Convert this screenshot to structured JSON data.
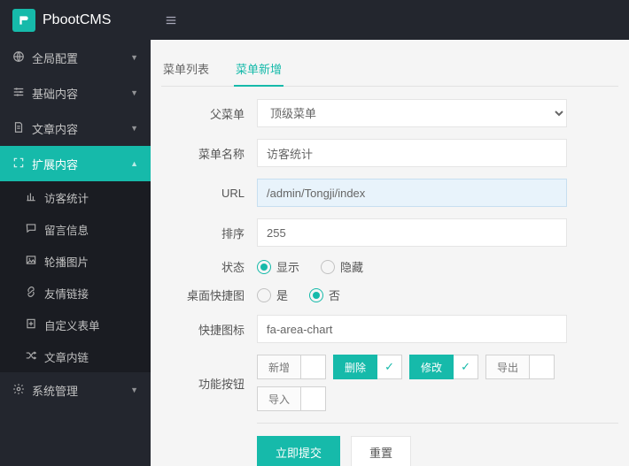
{
  "brand": {
    "name": "PbootCMS",
    "logo_glyph": "⎙"
  },
  "sidebar": {
    "items": [
      {
        "label": "全局配置",
        "icon": "globe"
      },
      {
        "label": "基础内容",
        "icon": "sliders"
      },
      {
        "label": "文章内容",
        "icon": "doc"
      },
      {
        "label": "扩展内容",
        "icon": "expand",
        "active": true,
        "children": [
          {
            "label": "访客统计",
            "icon": "chart"
          },
          {
            "label": "留言信息",
            "icon": "msg"
          },
          {
            "label": "轮播图片",
            "icon": "image"
          },
          {
            "label": "友情链接",
            "icon": "link"
          },
          {
            "label": "自定义表单",
            "icon": "form"
          },
          {
            "label": "文章内链",
            "icon": "shuffle"
          }
        ]
      },
      {
        "label": "系统管理",
        "icon": "gear"
      }
    ]
  },
  "tabs": {
    "list_label": "菜单列表",
    "add_label": "菜单新增"
  },
  "form": {
    "parent": {
      "label": "父菜单",
      "value": "顶级菜单"
    },
    "name": {
      "label": "菜单名称",
      "value": "访客统计"
    },
    "url": {
      "label": "URL",
      "value": "/admin/Tongji/index"
    },
    "sort": {
      "label": "排序",
      "value": "255"
    },
    "status": {
      "label": "状态",
      "opt_show": "显示",
      "opt_hide": "隐藏",
      "value": "show"
    },
    "desktop": {
      "label": "桌面快捷图",
      "opt_yes": "是",
      "opt_no": "否",
      "value": "no"
    },
    "icon": {
      "label": "快捷图标",
      "value": "fa-area-chart"
    },
    "actions": {
      "label": "功能按钮",
      "items": [
        {
          "label": "新增",
          "on": false
        },
        {
          "label": "删除",
          "on": true
        },
        {
          "label": "修改",
          "on": true
        },
        {
          "label": "导出",
          "on": false
        },
        {
          "label": "导入",
          "on": false
        }
      ]
    }
  },
  "buttons": {
    "submit": "立即提交",
    "reset": "重置"
  }
}
